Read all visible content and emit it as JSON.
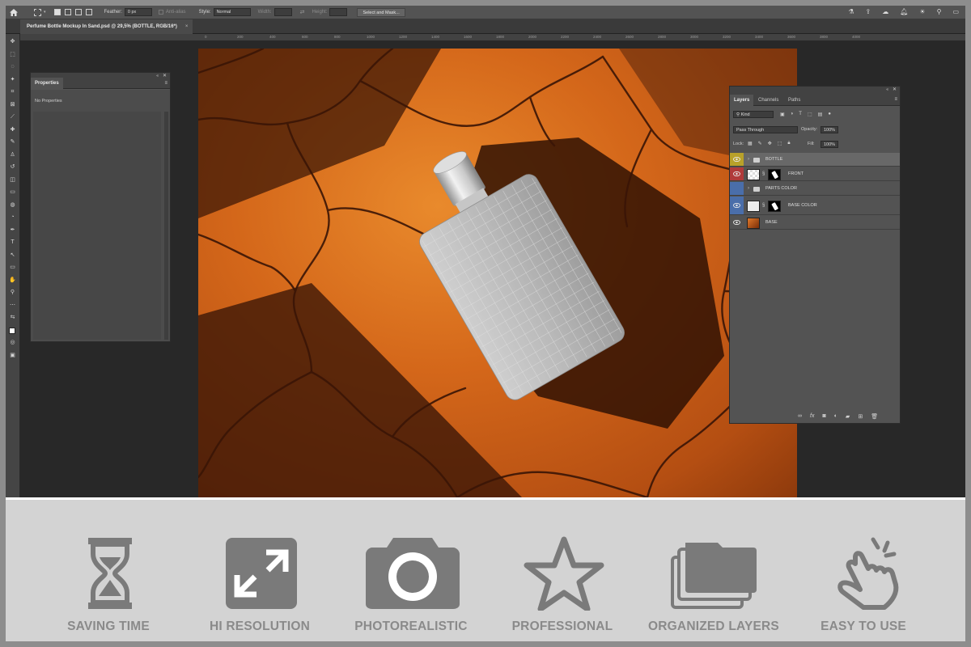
{
  "options_bar": {
    "feather_label": "Feather:",
    "feather_value": "0 px",
    "antialias_label": "Anti-alias",
    "style_label": "Style:",
    "style_value": "Normal",
    "width_label": "Width:",
    "height_label": "Height:",
    "select_mask_label": "Select and Mask..."
  },
  "document_tab": {
    "title": "Perfume Bottle Mockup In Sand.psd @ 29,5% (BOTTLE, RGB/16*)",
    "close": "×"
  },
  "ruler_ticks": [
    "0",
    "200",
    "400",
    "600",
    "800",
    "1000",
    "1200",
    "1400",
    "1600",
    "1800",
    "2000",
    "2200",
    "2400",
    "2600",
    "2800",
    "3000",
    "3200",
    "3400",
    "3600",
    "3800",
    "4000"
  ],
  "properties_panel": {
    "tab": "Properties",
    "empty_text": "No Properties"
  },
  "layers_panel": {
    "tabs": [
      "Layers",
      "Channels",
      "Paths"
    ],
    "filter_kind": "Kind",
    "blend_mode": "Pass Through",
    "opacity_label": "Opacity:",
    "opacity_value": "100%",
    "lock_label": "Lock:",
    "fill_label": "Fill:",
    "fill_value": "100%",
    "layers": [
      {
        "name": "BOTTLE",
        "type": "group",
        "color": "#b8a12a",
        "selected": true
      },
      {
        "name": "FRONT",
        "type": "smart",
        "color": "#b03a3a",
        "selected": false
      },
      {
        "name": "PARTS COLOR",
        "type": "group",
        "color": "#4a6eaa",
        "selected": false
      },
      {
        "name": "BASE COLOR",
        "type": "smart",
        "color": "#4a6eaa",
        "selected": false
      },
      {
        "name": "BASE",
        "type": "image",
        "color": "",
        "selected": false
      }
    ]
  },
  "features": [
    {
      "label": "SAVING TIME",
      "icon": "hourglass-icon"
    },
    {
      "label": "HI RESOLUTION",
      "icon": "expand-arrows-icon"
    },
    {
      "label": "PHOTOREALISTIC",
      "icon": "camera-icon"
    },
    {
      "label": "PROFESSIONAL",
      "icon": "star-icon"
    },
    {
      "label": "ORGANIZED LAYERS",
      "icon": "folders-icon"
    },
    {
      "label": "EASY TO USE",
      "icon": "tap-hand-icon"
    }
  ],
  "colors": {
    "feature_icon": "#7a7a7a",
    "panel_bg": "#535353",
    "sand_orange": "#d4671a"
  }
}
